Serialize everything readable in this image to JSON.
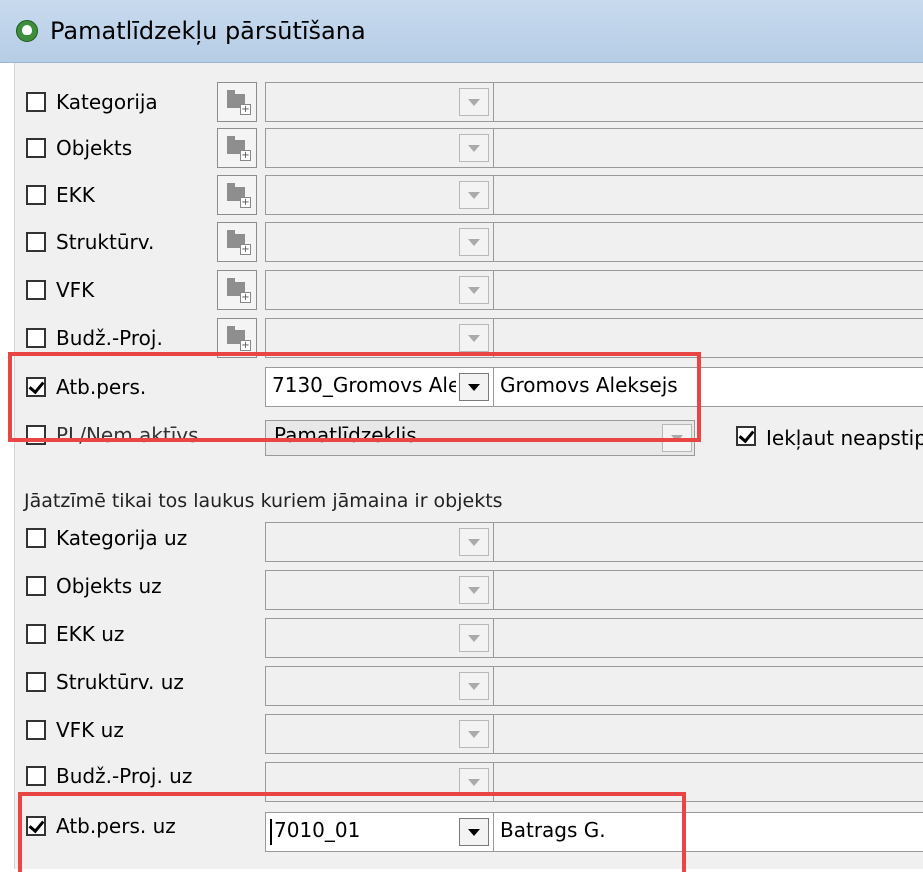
{
  "window": {
    "title": "Pamatlīdzekļu pārsūtīšana"
  },
  "filter_rows": [
    {
      "label": "Kategorija",
      "checked": false,
      "code": "",
      "name": ""
    },
    {
      "label": "Objekts",
      "checked": false,
      "code": "",
      "name": ""
    },
    {
      "label": "EKK",
      "checked": false,
      "code": "",
      "name": ""
    },
    {
      "label": "Struktūrv.",
      "checked": false,
      "code": "",
      "name": ""
    },
    {
      "label": "VFK",
      "checked": false,
      "code": "",
      "name": ""
    },
    {
      "label": "Budž.-Proj.",
      "checked": false,
      "code": "",
      "name": ""
    },
    {
      "label": "Atb.pers.",
      "checked": true,
      "code": "7130_Gromovs Ale",
      "name": "Gromovs Aleksejs"
    }
  ],
  "type_row": {
    "label": "PL/Nem.aktīvs",
    "checked": false,
    "value": "Pamatlīdzeklis",
    "include_label": "Iekļaut neapstipr",
    "include_checked": true
  },
  "hint": "Jāatzīmē tikai tos laukus kuriem jāmaina ir objekts",
  "target_rows": [
    {
      "label": "Kategorija uz",
      "checked": false,
      "code": "",
      "name": ""
    },
    {
      "label": "Objekts uz",
      "checked": false,
      "code": "",
      "name": ""
    },
    {
      "label": "EKK uz",
      "checked": false,
      "code": "",
      "name": ""
    },
    {
      "label": "Struktūrv. uz",
      "checked": false,
      "code": "",
      "name": ""
    },
    {
      "label": "VFK uz",
      "checked": false,
      "code": "",
      "name": ""
    },
    {
      "label": "Budž.-Proj. uz",
      "checked": false,
      "code": "",
      "name": ""
    },
    {
      "label": "Atb.pers. uz",
      "checked": true,
      "code": "7010_01",
      "name": "Batrags G."
    }
  ],
  "colors": {
    "highlight": "#e94545",
    "titlebar": "#c8daee",
    "panel": "#f0f0f0"
  }
}
